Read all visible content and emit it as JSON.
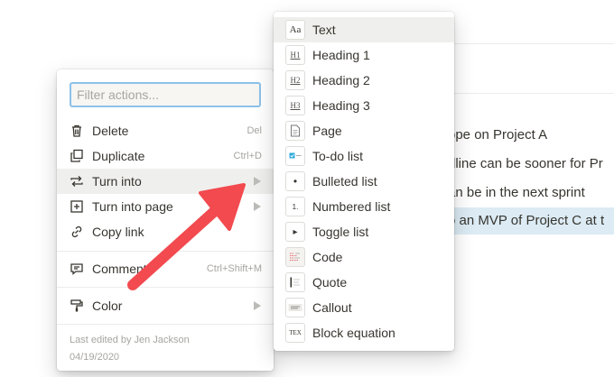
{
  "document": {
    "lines": [
      "ope on Project A",
      "dline can be sooner for Pr",
      "an be in the next sprint",
      "o an MVP of Project C at t"
    ]
  },
  "menu": {
    "filter_placeholder": "Filter actions...",
    "items": [
      {
        "label": "Delete",
        "shortcut": "Del",
        "icon": "trash-icon"
      },
      {
        "label": "Duplicate",
        "shortcut": "Ctrl+D",
        "icon": "duplicate-icon"
      },
      {
        "label": "Turn into",
        "shortcut": "",
        "icon": "turn-into-icon",
        "has_submenu": true,
        "active": true
      },
      {
        "label": "Turn into page",
        "shortcut": "",
        "icon": "add-page-icon",
        "has_submenu": true
      },
      {
        "label": "Copy link",
        "shortcut": "",
        "icon": "link-icon"
      },
      {
        "label": "Comment",
        "shortcut": "Ctrl+Shift+M",
        "icon": "comment-icon"
      },
      {
        "label": "Color",
        "shortcut": "",
        "icon": "paint-roller-icon",
        "has_submenu": true
      }
    ],
    "footer": {
      "edited_by": "Last edited by Jen Jackson",
      "date": "04/19/2020"
    }
  },
  "submenu": {
    "items": [
      {
        "label": "Text",
        "icon": "text-block-icon",
        "glyph": "Aa",
        "active": true
      },
      {
        "label": "Heading 1",
        "icon": "heading1-icon",
        "glyph": "H1"
      },
      {
        "label": "Heading 2",
        "icon": "heading2-icon",
        "glyph": "H2"
      },
      {
        "label": "Heading 3",
        "icon": "heading3-icon",
        "glyph": "H3"
      },
      {
        "label": "Page",
        "icon": "page-icon",
        "glyph": ""
      },
      {
        "label": "To-do list",
        "icon": "todo-icon",
        "glyph": ""
      },
      {
        "label": "Bulleted list",
        "icon": "bulleted-list-icon",
        "glyph": "•"
      },
      {
        "label": "Numbered list",
        "icon": "numbered-list-icon",
        "glyph": "1."
      },
      {
        "label": "Toggle list",
        "icon": "toggle-list-icon",
        "glyph": "▸"
      },
      {
        "label": "Code",
        "icon": "code-icon",
        "glyph": ""
      },
      {
        "label": "Quote",
        "icon": "quote-icon",
        "glyph": ""
      },
      {
        "label": "Callout",
        "icon": "callout-icon",
        "glyph": ""
      },
      {
        "label": "Block equation",
        "icon": "equation-icon",
        "glyph": "TEX"
      }
    ]
  },
  "colors": {
    "annotation_arrow": "#f24a4f",
    "highlight": "#dcebf4",
    "filter_border": "#8cc2ea",
    "active_row": "#efefed"
  }
}
